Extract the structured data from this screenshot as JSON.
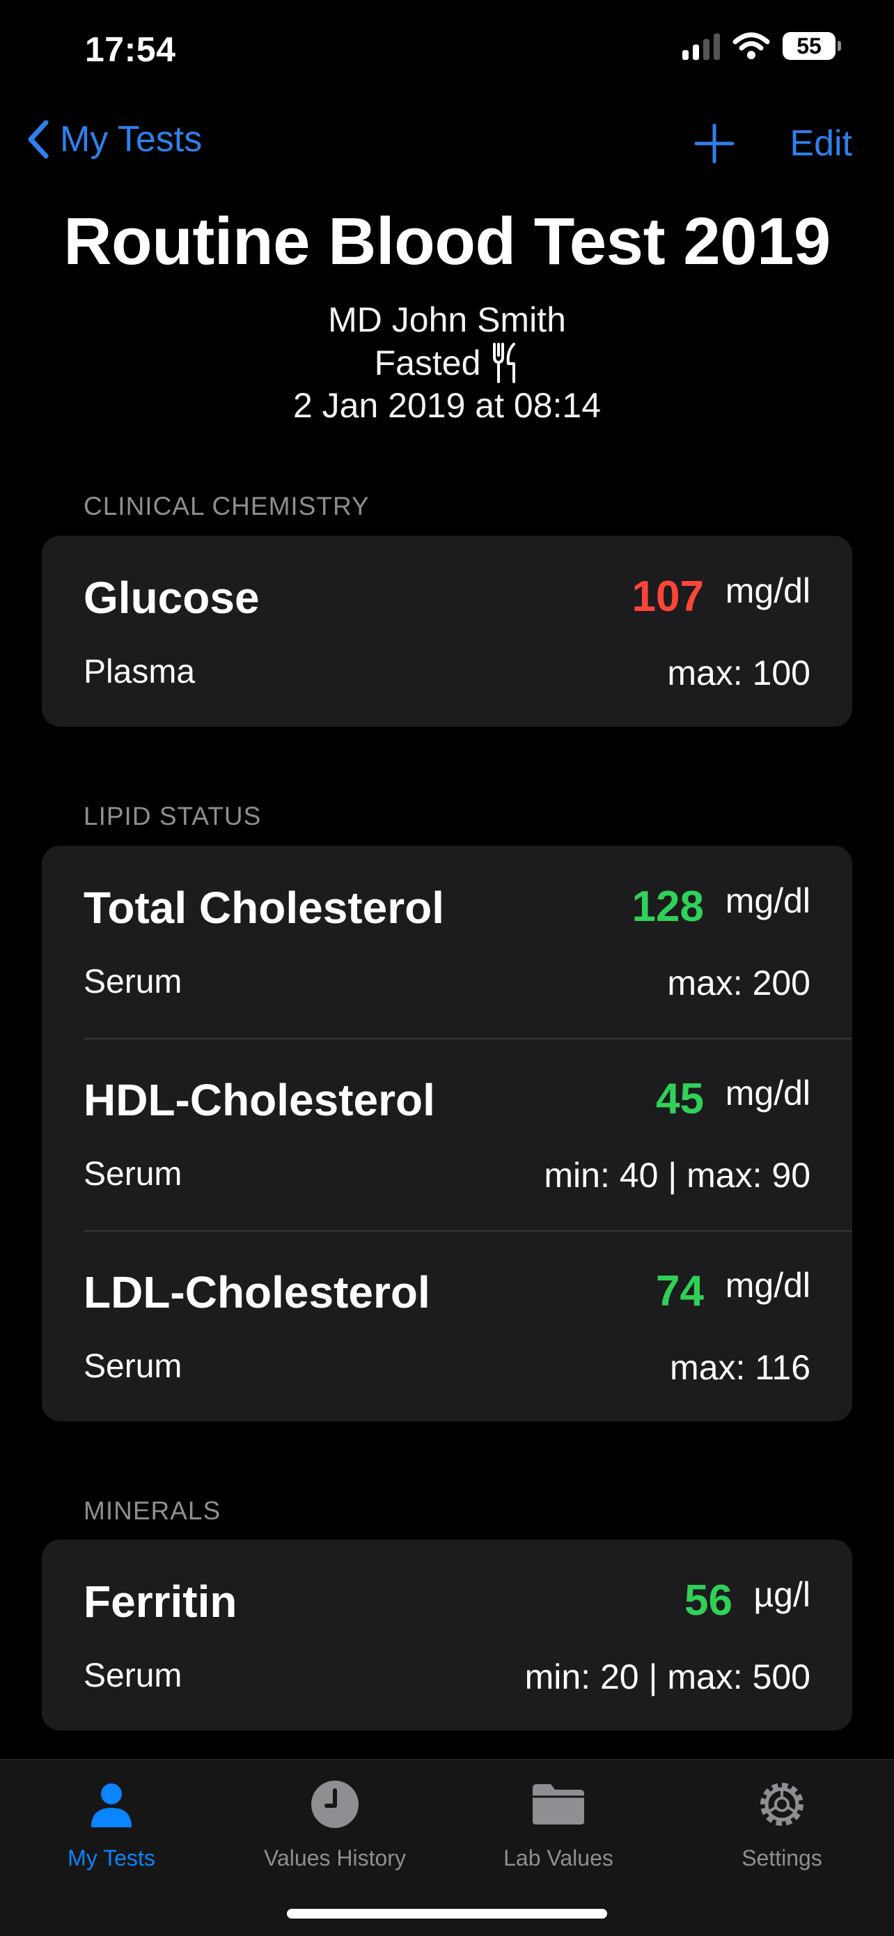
{
  "status_bar": {
    "time": "17:54",
    "battery": "55"
  },
  "nav": {
    "back_label": "My Tests",
    "add_icon": "plus-icon",
    "edit_label": "Edit"
  },
  "header": {
    "title": "Routine Blood Test 2019",
    "doctor": "MD John Smith",
    "fasting": "Fasted",
    "date": "2 Jan 2019 at 08:14"
  },
  "sections": [
    {
      "title": "CLINICAL CHEMISTRY",
      "rows": [
        {
          "name": "Glucose",
          "value": "107",
          "unit": "mg/dl",
          "specimen": "Plasma",
          "range": "max: 100",
          "status": "high"
        }
      ]
    },
    {
      "title": "LIPID STATUS",
      "rows": [
        {
          "name": "Total Cholesterol",
          "value": "128",
          "unit": "mg/dl",
          "specimen": "Serum",
          "range": "max: 200",
          "status": "normal"
        },
        {
          "name": "HDL-Cholesterol",
          "value": "45",
          "unit": "mg/dl",
          "specimen": "Serum",
          "range": "min: 40 | max: 90",
          "status": "normal"
        },
        {
          "name": "LDL-Cholesterol",
          "value": "74",
          "unit": "mg/dl",
          "specimen": "Serum",
          "range": "max: 116",
          "status": "normal"
        }
      ]
    },
    {
      "title": "MINERALS",
      "rows": [
        {
          "name": "Ferritin",
          "value": "56",
          "unit": "µg/l",
          "specimen": "Serum",
          "range": "min: 20 | max: 500",
          "status": "normal"
        }
      ]
    }
  ],
  "tabs": [
    {
      "label": "My Tests",
      "icon": "person-icon",
      "active": true
    },
    {
      "label": "Values History",
      "icon": "clock-icon",
      "active": false
    },
    {
      "label": "Lab Values",
      "icon": "folder-icon",
      "active": false
    },
    {
      "label": "Settings",
      "icon": "gear-icon",
      "active": false
    }
  ],
  "colors": {
    "accent": "#0a84ff",
    "high": "#ff453a",
    "normal": "#30d158",
    "card": "#1c1c1e"
  }
}
